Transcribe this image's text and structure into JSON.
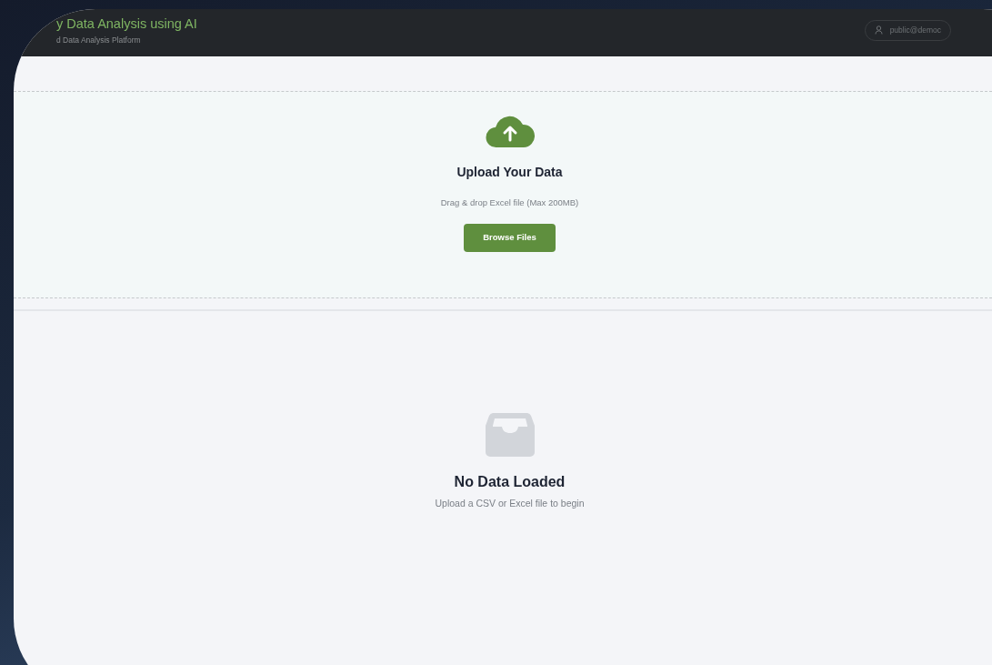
{
  "header": {
    "title": "y Data Analysis using AI",
    "subtitle": "d Data Analysis Platform",
    "user": "public@democ"
  },
  "upload": {
    "title": "Upload Your Data",
    "hint": "Drag & drop Excel file (Max 200MB)",
    "button": "Browse Files"
  },
  "empty_state": {
    "title": "No Data Loaded",
    "message": "Upload a CSV or Excel file to begin"
  }
}
